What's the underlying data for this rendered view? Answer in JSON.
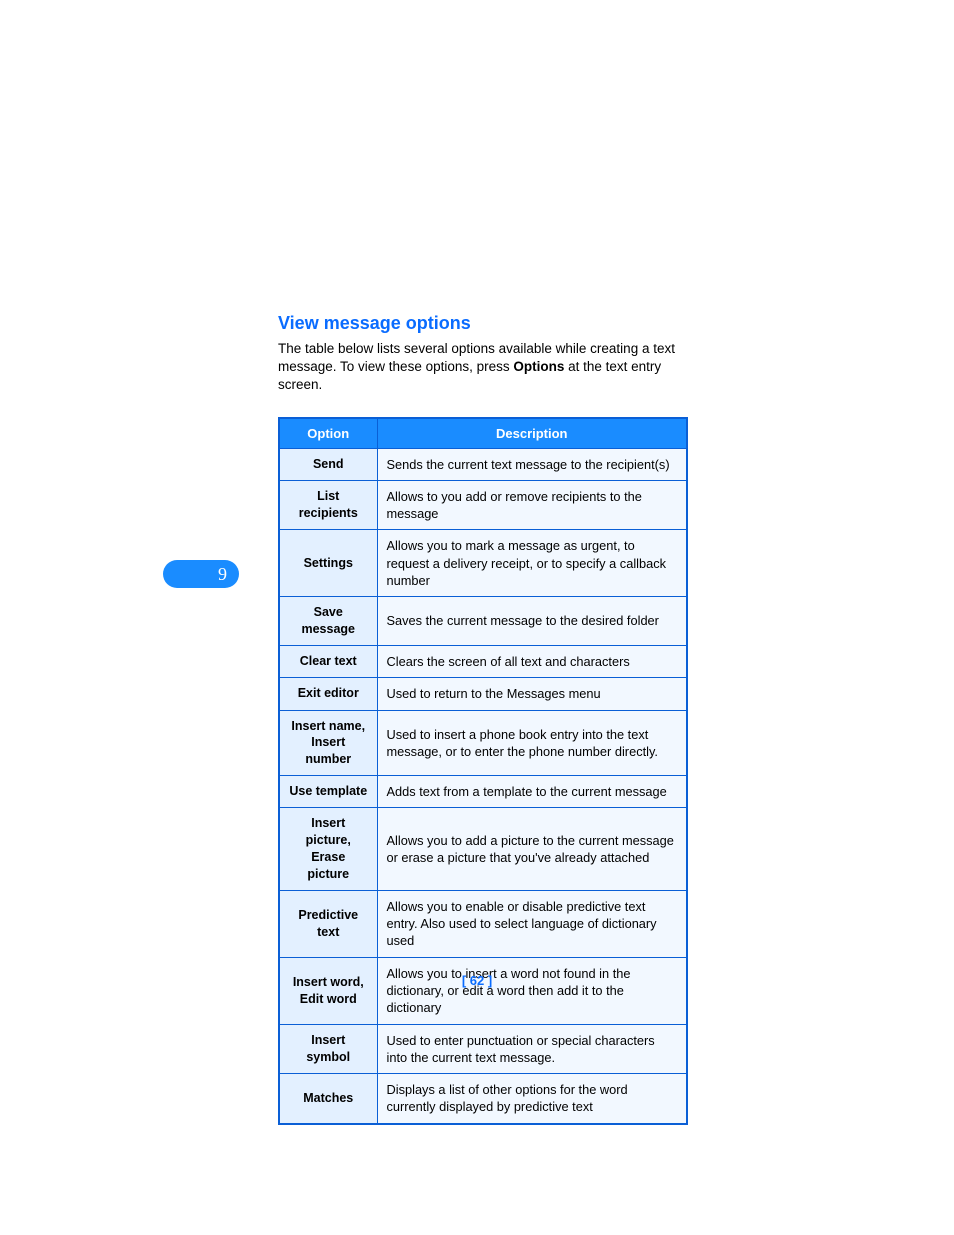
{
  "chapter_number": "9",
  "section_title": "View message options",
  "intro_before": "The table below lists several options available while creating a text message. To view these options, press ",
  "intro_bold": "Options",
  "intro_after": " at the text entry screen.",
  "table_headers": {
    "option": "Option",
    "description": "Description"
  },
  "options": [
    {
      "name": "Send",
      "desc": "Sends the current text message to the recipient(s)"
    },
    {
      "name": "List recipients",
      "desc": "Allows to you add or remove recipients to the message"
    },
    {
      "name": "Settings",
      "desc": "Allows you to mark a message as urgent, to request a delivery receipt, or to specify a callback number"
    },
    {
      "name": "Save message",
      "desc": "Saves the current message to the desired folder"
    },
    {
      "name": "Clear text",
      "desc": "Clears the screen of all text and characters"
    },
    {
      "name": "Exit editor",
      "desc": "Used to return to the Messages menu"
    },
    {
      "name": "Insert name, Insert number",
      "desc": "Used to insert a phone book entry into the text message, or to enter the phone number directly."
    },
    {
      "name": "Use template",
      "desc": "Adds text from a template to the current message"
    },
    {
      "name": "Insert picture, Erase picture",
      "desc": "Allows you to add a picture to the current message or erase a picture that you've already attached"
    },
    {
      "name": "Predictive text",
      "desc": "Allows you to enable or disable predictive text entry. Also used to select language of dictionary used"
    },
    {
      "name": "Insert word, Edit word",
      "desc": "Allows you to insert a word not found in the dictionary, or edit a word then add it to the dictionary"
    },
    {
      "name": "Insert symbol",
      "desc": "Used to enter punctuation or special characters into the current text message."
    },
    {
      "name": "Matches",
      "desc": "Displays a list of other options for the word currently displayed by predictive text"
    }
  ],
  "page_number": "[ 62 ]"
}
